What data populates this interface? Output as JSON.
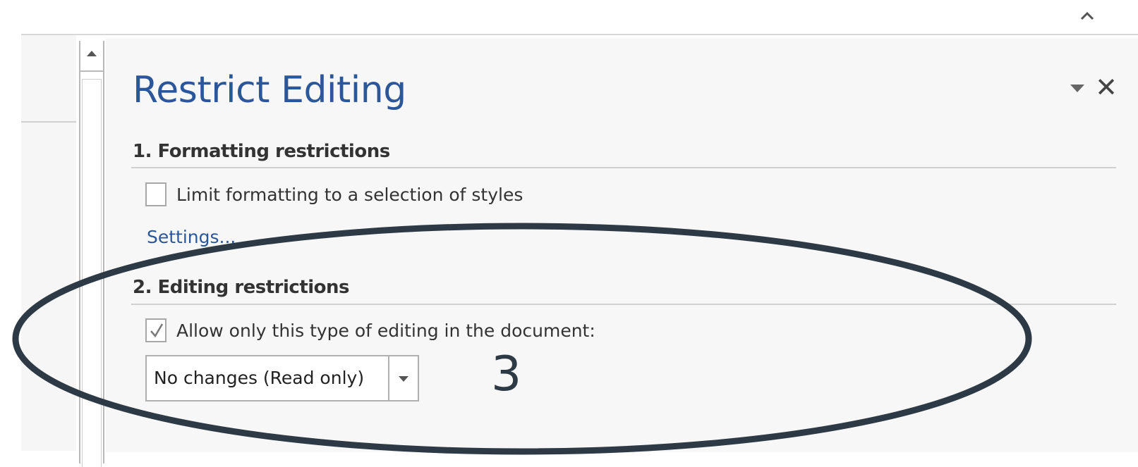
{
  "ribbon": {
    "collapse_icon": "chevron-up-icon"
  },
  "pane": {
    "title": "Restrict Editing",
    "options_icon": "dropdown-triangle-icon",
    "close_label": "✕"
  },
  "sections": [
    {
      "heading": "1. Formatting restrictions",
      "checkbox_label": "Limit formatting to a selection of styles",
      "checked": false,
      "link_label": "Settings..."
    },
    {
      "heading": "2. Editing restrictions",
      "checkbox_label": "Allow only this type of editing in the document:",
      "checked": true,
      "dropdown_value": "No changes (Read only)"
    }
  ],
  "annotation": {
    "number": "3",
    "color": "#2d3a45"
  },
  "colors": {
    "title_blue": "#2b579a",
    "pane_background": "#f7f7f7"
  }
}
